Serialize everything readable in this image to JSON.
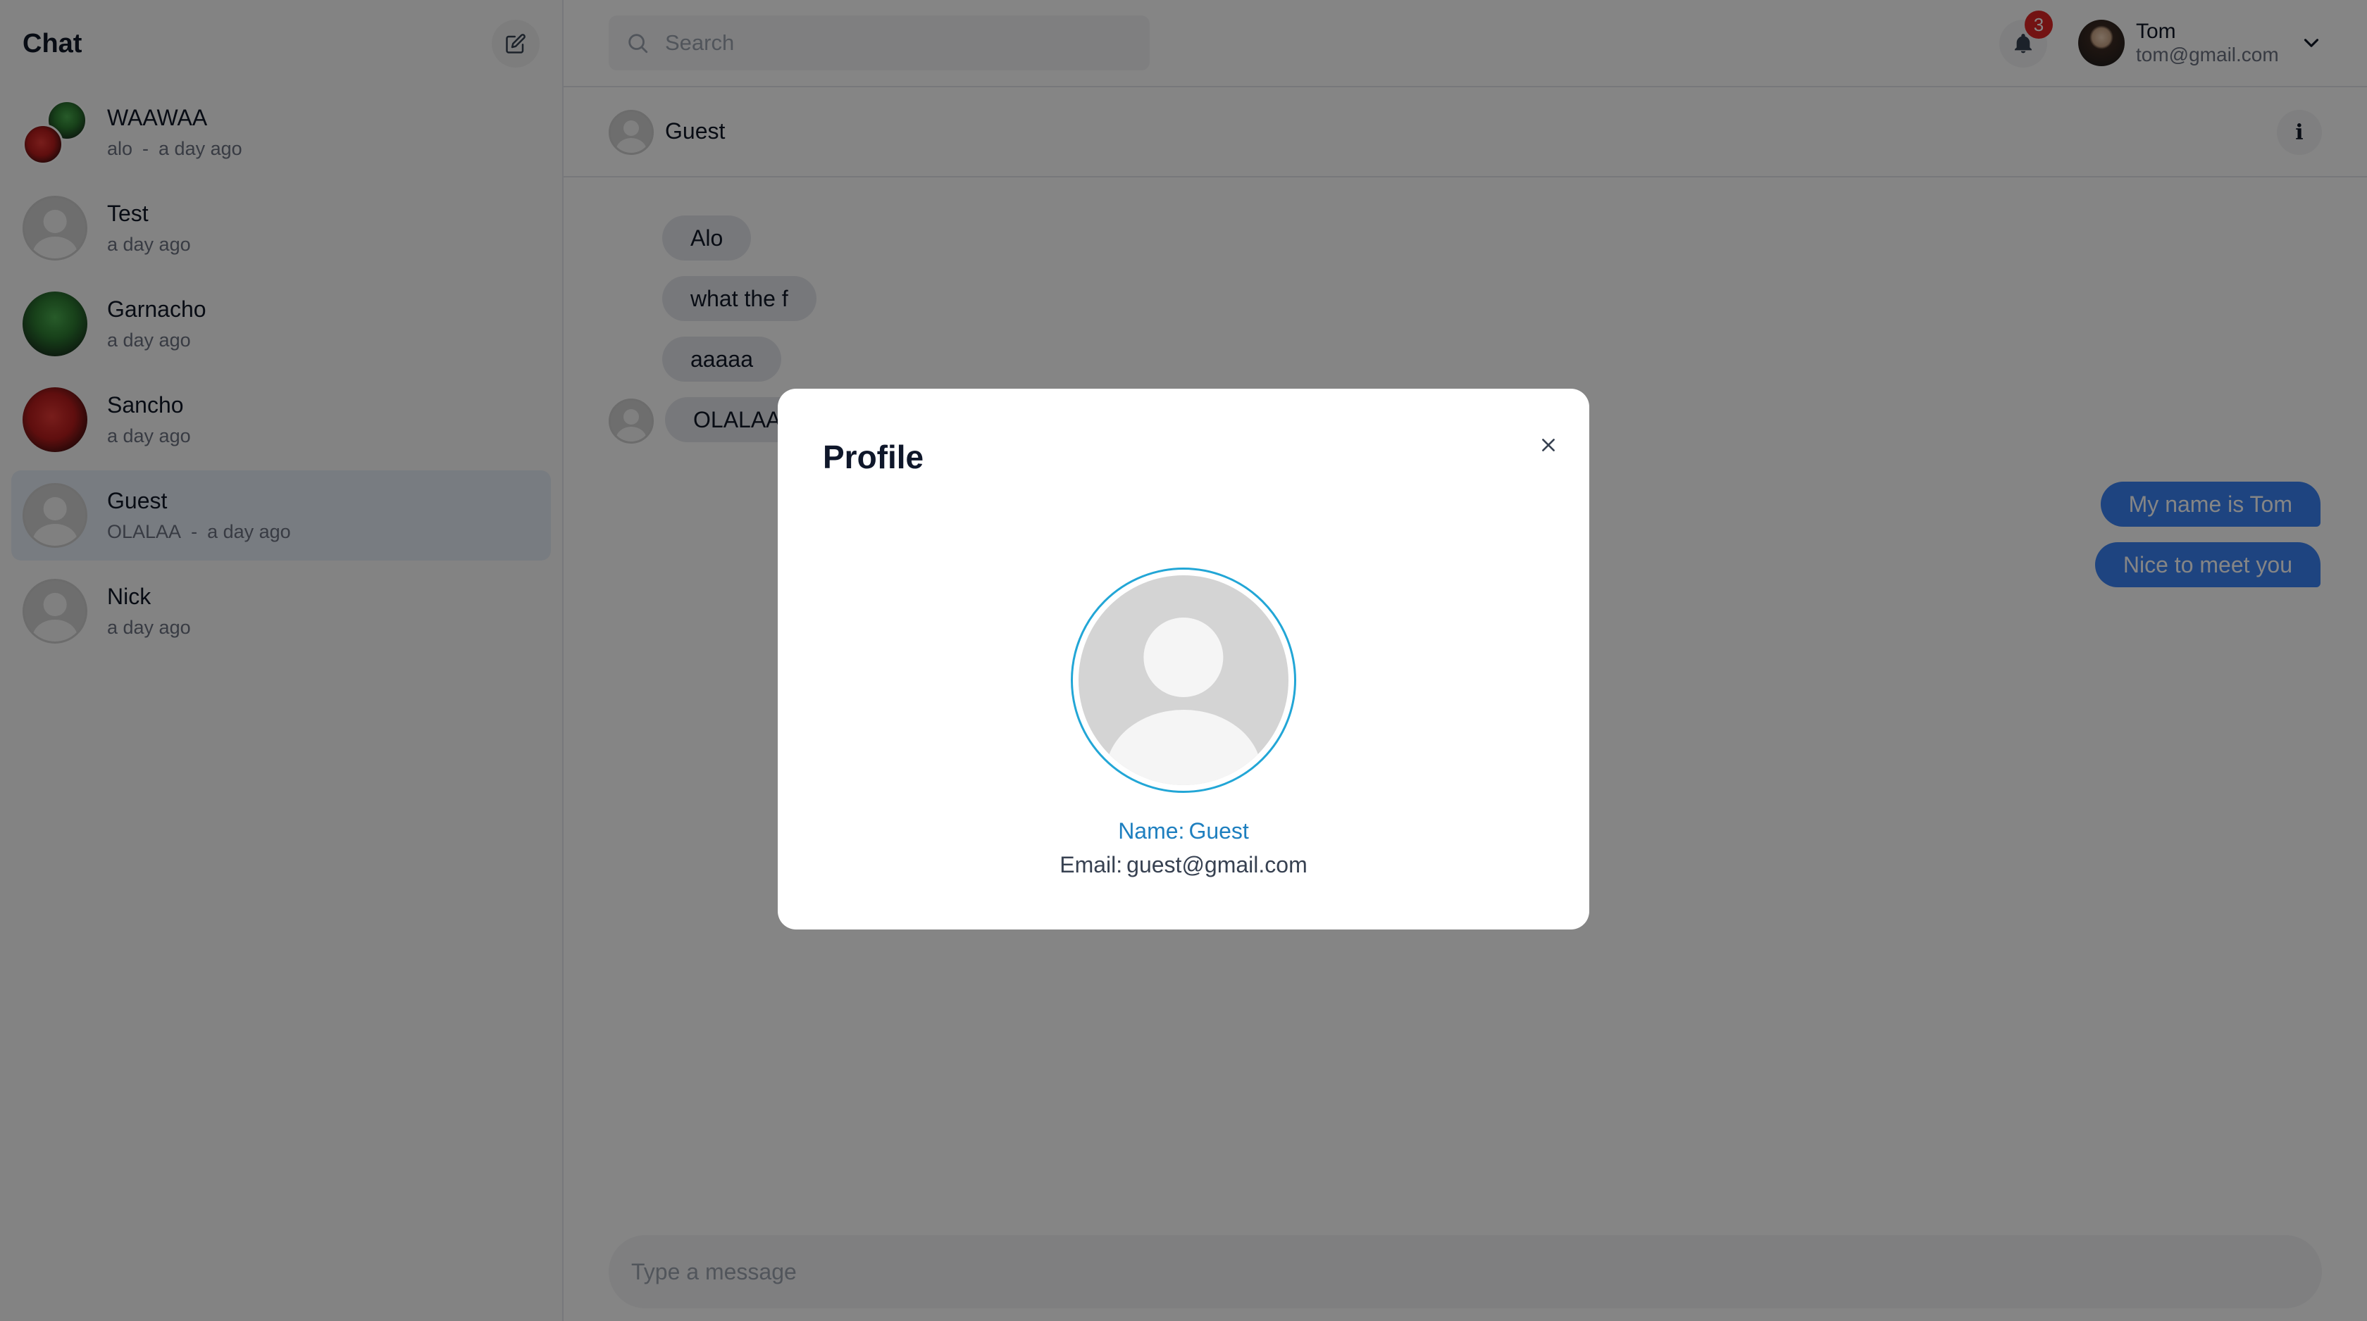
{
  "sidebar": {
    "title": "Chat",
    "compose_icon": "compose-icon",
    "conversations": [
      {
        "name": "WAAWAA",
        "last_message": "alo",
        "separator": "-",
        "time": "a day ago",
        "avatar": "group"
      },
      {
        "name": "Test",
        "last_message": "",
        "separator": "",
        "time": "a day ago",
        "avatar": "default"
      },
      {
        "name": "Garnacho",
        "last_message": "",
        "separator": "",
        "time": "a day ago",
        "avatar": "photo"
      },
      {
        "name": "Sancho",
        "last_message": "",
        "separator": "",
        "time": "a day ago",
        "avatar": "photo"
      },
      {
        "name": "Guest",
        "last_message": "OLALAA",
        "separator": "-",
        "time": "a day ago",
        "avatar": "default",
        "active": true
      },
      {
        "name": "Nick",
        "last_message": "",
        "separator": "",
        "time": "a day ago",
        "avatar": "default"
      }
    ]
  },
  "topbar": {
    "search_placeholder": "Search",
    "notification_count": "3",
    "user_name": "Tom",
    "user_email": "tom@gmail.com"
  },
  "conversation": {
    "name": "Guest",
    "info_label": "i",
    "messages_incoming": [
      "Alo",
      "what the f",
      "aaaaa",
      "OLALAA"
    ],
    "messages_outgoing": [
      "My name is Tom",
      "Nice to meet you"
    ],
    "composer_placeholder": "Type a message"
  },
  "modal": {
    "title": "Profile",
    "name_label": "Name:",
    "name_value": "Guest",
    "email_label": "Email:",
    "email_value": "guest@gmail.com"
  },
  "colors": {
    "accent": "#3b82f6",
    "badge": "#dc2626",
    "profile_ring": "#22a6d6",
    "overlay": "rgba(0,0,0,0.48)"
  }
}
